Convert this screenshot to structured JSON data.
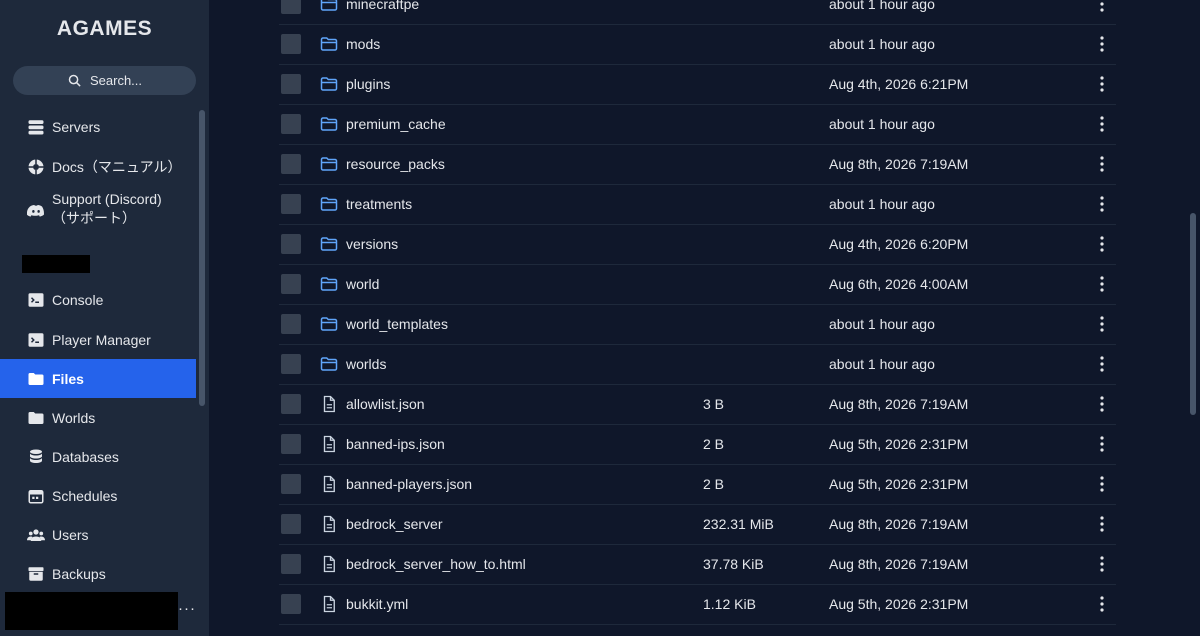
{
  "sidebar": {
    "brand": "AGAMES",
    "search_label": "Search...",
    "nav": [
      {
        "label": "Servers",
        "icon": "servers-icon"
      },
      {
        "label": "Docs（マニュアル）",
        "icon": "docs-icon"
      },
      {
        "label": "Support (Discord)\n（サポート）",
        "icon": "discord-icon"
      },
      {
        "label": "Console",
        "icon": "console-icon"
      },
      {
        "label": "Player Manager",
        "icon": "player-manager-icon"
      },
      {
        "label": "Files",
        "icon": "folder-open-icon",
        "active": true
      },
      {
        "label": "Worlds",
        "icon": "worlds-icon"
      },
      {
        "label": "Databases",
        "icon": "database-icon"
      },
      {
        "label": "Schedules",
        "icon": "schedules-icon"
      },
      {
        "label": "Users",
        "icon": "users-icon"
      },
      {
        "label": "Backups",
        "icon": "backups-icon"
      }
    ],
    "more_label": "···"
  },
  "files": [
    {
      "type": "folder",
      "name": "minecraftpe",
      "size": "",
      "modified": "about 1 hour ago"
    },
    {
      "type": "folder",
      "name": "mods",
      "size": "",
      "modified": "about 1 hour ago"
    },
    {
      "type": "folder",
      "name": "plugins",
      "size": "",
      "modified": "Aug 4th, 2026 6:21PM"
    },
    {
      "type": "folder",
      "name": "premium_cache",
      "size": "",
      "modified": "about 1 hour ago"
    },
    {
      "type": "folder",
      "name": "resource_packs",
      "size": "",
      "modified": "Aug 8th, 2026 7:19AM"
    },
    {
      "type": "folder",
      "name": "treatments",
      "size": "",
      "modified": "about 1 hour ago"
    },
    {
      "type": "folder",
      "name": "versions",
      "size": "",
      "modified": "Aug 4th, 2026 6:20PM"
    },
    {
      "type": "folder",
      "name": "world",
      "size": "",
      "modified": "Aug 6th, 2026 4:00AM"
    },
    {
      "type": "folder",
      "name": "world_templates",
      "size": "",
      "modified": "about 1 hour ago"
    },
    {
      "type": "folder",
      "name": "worlds",
      "size": "",
      "modified": "about 1 hour ago"
    },
    {
      "type": "file",
      "name": "allowlist.json",
      "size": "3 B",
      "modified": "Aug 8th, 2026 7:19AM"
    },
    {
      "type": "file",
      "name": "banned-ips.json",
      "size": "2 B",
      "modified": "Aug 5th, 2026 2:31PM"
    },
    {
      "type": "file",
      "name": "banned-players.json",
      "size": "2 B",
      "modified": "Aug 5th, 2026 2:31PM"
    },
    {
      "type": "file",
      "name": "bedrock_server",
      "size": "232.31 MiB",
      "modified": "Aug 8th, 2026 7:19AM"
    },
    {
      "type": "file",
      "name": "bedrock_server_how_to.html",
      "size": "37.78 KiB",
      "modified": "Aug 8th, 2026 7:19AM"
    },
    {
      "type": "file",
      "name": "bukkit.yml",
      "size": "1.12 KiB",
      "modified": "Aug 5th, 2026 2:31PM"
    }
  ],
  "colors": {
    "accent": "#2563eb",
    "folder": "#60a5fa",
    "sidebar_bg": "#1e293b",
    "main_bg": "#0f172a"
  }
}
